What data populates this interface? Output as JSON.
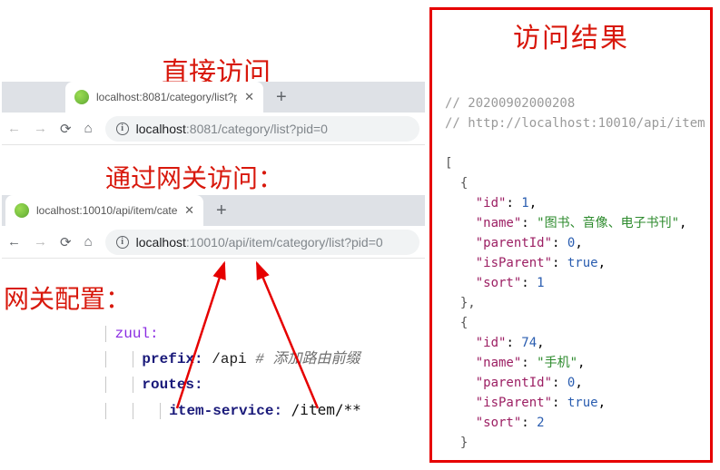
{
  "annotations": {
    "title_direct": "直接访问",
    "title_gateway": "通过网关访问：",
    "title_config": "网关配置：",
    "title_result": "访问结果"
  },
  "browser1": {
    "tab_title": "localhost:8081/category/list?p",
    "url_host": "localhost",
    "url_path": ":8081/category/list?pid=0"
  },
  "browser2": {
    "tab_title": "localhost:10010/api/item/cate",
    "url_host": "localhost",
    "url_path": ":10010/api/item/category/list?pid=0"
  },
  "yaml": {
    "root": "zuul",
    "prefix_key": "prefix",
    "prefix_val": "/api",
    "prefix_comment": "# 添加路由前缀",
    "routes_key": "routes",
    "item_key": "item-service",
    "item_val": "/item/**"
  },
  "result": {
    "comment1": "// 20200902000208",
    "comment2": "// http://localhost:10010/api/item",
    "items": [
      {
        "id": 1,
        "name": "图书、音像、电子书刊",
        "parentId": 0,
        "isParent": true,
        "sort": 1
      },
      {
        "id": 74,
        "name": "手机",
        "parentId": 0,
        "isParent": true,
        "sort": 2
      }
    ]
  }
}
